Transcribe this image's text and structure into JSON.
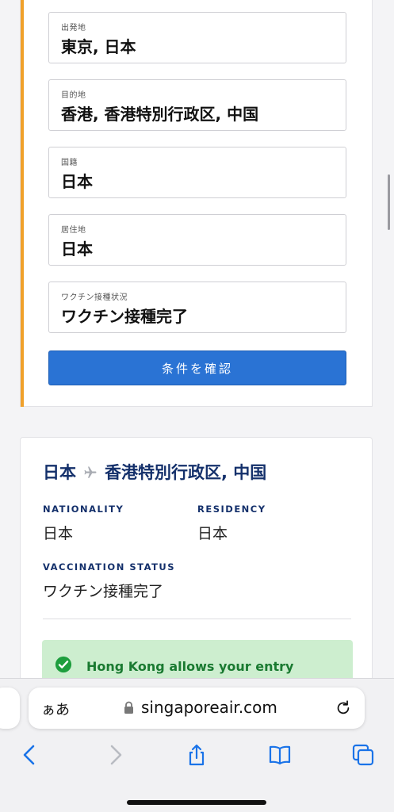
{
  "form": {
    "fields": [
      {
        "label": "出発地",
        "value": "東京, 日本"
      },
      {
        "label": "目的地",
        "value": "香港, 香港特別行政区, 中国"
      },
      {
        "label": "国籍",
        "value": "日本"
      },
      {
        "label": "居住地",
        "value": "日本"
      },
      {
        "label": "ワクチン接種状況",
        "value": "ワクチン接種完了"
      }
    ],
    "confirm_label": "条件を確認"
  },
  "result": {
    "origin": "日本",
    "destination": "香港特別行政区, 中国",
    "nationality_label": "NATIONALITY",
    "nationality_value": "日本",
    "residency_label": "RESIDENCY",
    "residency_value": "日本",
    "vaccination_label": "VACCINATION STATUS",
    "vaccination_value": "ワクチン接種完了",
    "allow_text": "Hong Kong allows your entry"
  },
  "browser": {
    "text_size_label": "ぁあ",
    "url": "singaporeair.com"
  },
  "colors": {
    "accent": "#f0a12b",
    "primary_button": "#2a73d4",
    "navy": "#14306b",
    "success_bg": "#cdeecf",
    "success_text": "#1a7a31",
    "ios_blue": "#1a73e8"
  },
  "icons": [
    "plane-icon",
    "check-circle-icon",
    "lock-icon",
    "reload-icon",
    "back-icon",
    "forward-icon",
    "share-icon",
    "bookmarks-icon",
    "tabs-icon"
  ]
}
